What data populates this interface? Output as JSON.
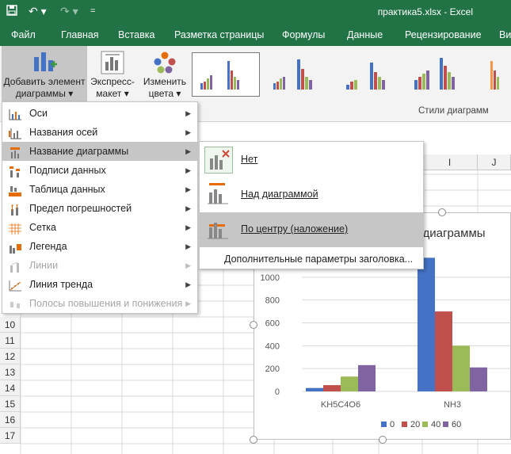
{
  "titlebar": {
    "title": "практика5.xlsx - Excel",
    "save_icon": "save-icon",
    "undo_icon": "undo-icon",
    "redo_icon": "redo-icon",
    "customize_icon": "customize-qat-icon"
  },
  "tabs": [
    "Файл",
    "Главная",
    "Вставка",
    "Разметка страницы",
    "Формулы",
    "Данные",
    "Рецензирование",
    "Ви"
  ],
  "ribbon": {
    "add_element": {
      "line1": "Добавить элемент",
      "line2": "диаграммы ▾"
    },
    "quick_layout": {
      "line1": "Экспресс-",
      "line2": "макет ▾"
    },
    "change_colors": {
      "line1": "Изменить",
      "line2": "цвета ▾"
    },
    "styles_group_label": "Стили диаграмм"
  },
  "menu": {
    "items": [
      {
        "label": "Оси",
        "icon": "axes-icon",
        "enabled": true
      },
      {
        "label": "Названия осей",
        "icon": "axis-titles-icon",
        "enabled": true
      },
      {
        "label": "Название диаграммы",
        "icon": "chart-title-icon",
        "enabled": true,
        "highlighted": true
      },
      {
        "label": "Подписи данных",
        "icon": "data-labels-icon",
        "enabled": true
      },
      {
        "label": "Таблица данных",
        "icon": "data-table-icon",
        "enabled": true
      },
      {
        "label": "Предел погрешностей",
        "icon": "error-bars-icon",
        "enabled": true
      },
      {
        "label": "Сетка",
        "icon": "gridlines-icon",
        "enabled": true
      },
      {
        "label": "Легенда",
        "icon": "legend-icon",
        "enabled": true
      },
      {
        "label": "Линии",
        "icon": "lines-icon",
        "enabled": false
      },
      {
        "label": "Линия тренда",
        "icon": "trendline-icon",
        "enabled": true
      },
      {
        "label": "Полосы повышения и понижения",
        "icon": "up-down-bars-icon",
        "enabled": false
      }
    ]
  },
  "submenu": {
    "none": "Нет",
    "above": "Над диаграммой",
    "centered": "По центру (наложение)",
    "more": "Дополнительные параметры заголовка..."
  },
  "grid": {
    "columns": [
      "I",
      "J"
    ],
    "rows": [
      "10",
      "11",
      "12",
      "13",
      "14",
      "15",
      "16",
      "17"
    ]
  },
  "chart_data": {
    "type": "bar",
    "title": "е диаграммы",
    "categories": [
      "KH5C4O6",
      "NH3"
    ],
    "series": [
      {
        "name": "0",
        "values": [
          30,
          1170
        ]
      },
      {
        "name": "20",
        "values": [
          55,
          700
        ]
      },
      {
        "name": "40",
        "values": [
          130,
          400
        ]
      },
      {
        "name": "60",
        "values": [
          230,
          210
        ]
      }
    ],
    "colors": [
      "#4472C4",
      "#C0504D",
      "#9BBB59",
      "#8064A2"
    ],
    "yticks": [
      "0",
      "200",
      "400",
      "600",
      "800",
      "1000"
    ],
    "ylim": [
      0,
      1200
    ],
    "legend": "bottom"
  }
}
